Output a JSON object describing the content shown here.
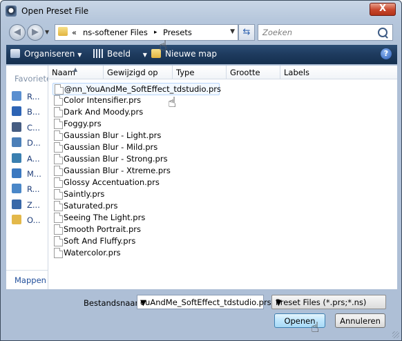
{
  "window": {
    "title": "Open Preset File",
    "close_label": "X"
  },
  "address": {
    "overflow": "«",
    "crumbs": [
      "ns-softener Files",
      "Presets"
    ],
    "separator": "▸"
  },
  "search": {
    "placeholder": "Zoeken"
  },
  "toolbar": {
    "organize": "Organiseren",
    "view": "Beeld",
    "new_folder": "Nieuwe map",
    "help": "?"
  },
  "sidebar": {
    "favorites_label": "Favoriete",
    "items": [
      {
        "label": "R...",
        "icon": "recent-places-icon",
        "color": "#5a8fd0"
      },
      {
        "label": "B...",
        "icon": "desktop-icon",
        "color": "#2d64b5"
      },
      {
        "label": "C...",
        "icon": "computer-icon",
        "color": "#465d82"
      },
      {
        "label": "D...",
        "icon": "documents-icon",
        "color": "#4b7fb8"
      },
      {
        "label": "A...",
        "icon": "pictures-icon",
        "color": "#3a7fb0"
      },
      {
        "label": "M...",
        "icon": "music-icon",
        "color": "#3a78c0"
      },
      {
        "label": "R...",
        "icon": "recently-changed-icon",
        "color": "#4a87c8"
      },
      {
        "label": "Z...",
        "icon": "searches-icon",
        "color": "#3868a8"
      },
      {
        "label": "O...",
        "icon": "public-folder-icon",
        "color": "#e3b84a"
      }
    ],
    "folders_label": "Mappen"
  },
  "columns": [
    "Naam",
    "Gewijzigd op",
    "Type",
    "Grootte",
    "Labels"
  ],
  "files": [
    "@nn_YouAndMe_SoftEffect_tdstudio.prs",
    "Color Intensifier.prs",
    "Dark And Moody.prs",
    "Foggy.prs",
    "Gaussian Blur - Light.prs",
    "Gaussian Blur - Mild.prs",
    "Gaussian Blur - Strong.prs",
    "Gaussian Blur - Xtreme.prs",
    "Glossy Accentuation.prs",
    "Saintly.prs",
    "Saturated.prs",
    "Seeing The Light.prs",
    "Smooth Portrait.prs",
    "Soft And Fluffy.prs",
    "Watercolor.prs"
  ],
  "footer": {
    "filename_label": "Bestandsnaam:",
    "filename_value": "ouAndMe_SoftEffect_tdstudio.prs",
    "filetype_value": "Preset Files (*.prs;*.ns)",
    "open_label": "Openen",
    "cancel_label": "Annuleren"
  }
}
